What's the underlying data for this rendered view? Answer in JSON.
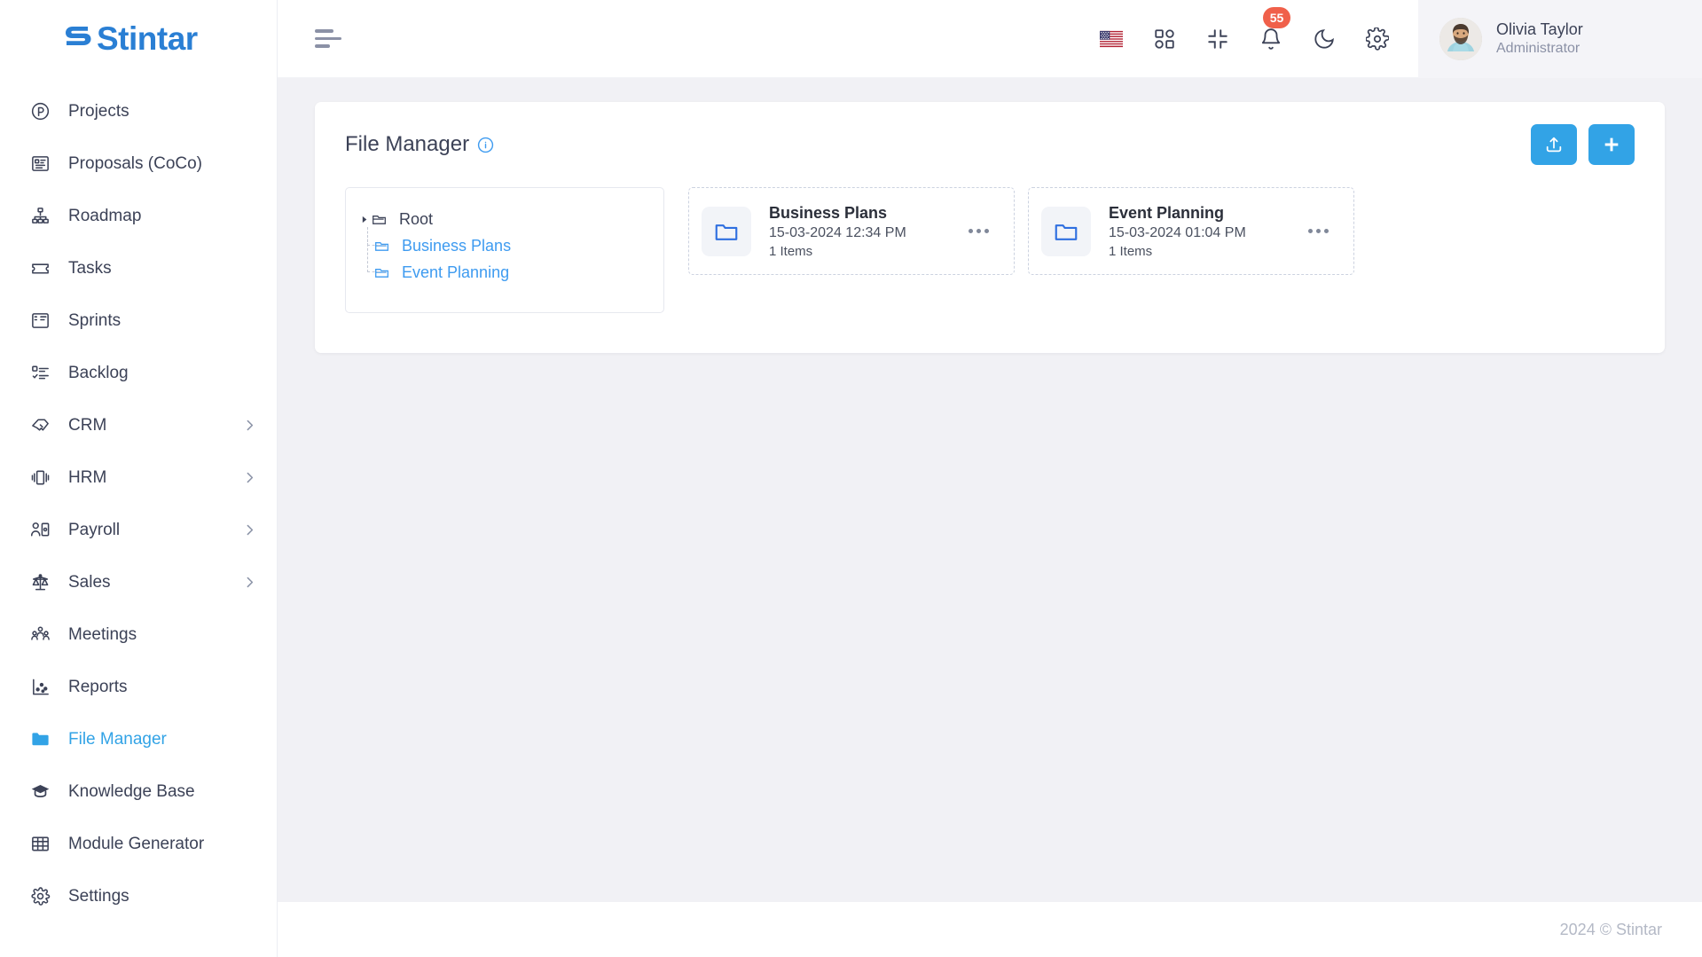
{
  "brand": {
    "name": "Stintar",
    "logo_color": "#2a7fd4"
  },
  "sidebar": {
    "items": [
      {
        "label": "Projects",
        "icon": "circle-p-icon",
        "active": false,
        "has_chevron": false
      },
      {
        "label": "Proposals (CoCo)",
        "icon": "proposal-icon",
        "active": false,
        "has_chevron": false
      },
      {
        "label": "Roadmap",
        "icon": "sitemap-icon",
        "active": false,
        "has_chevron": false
      },
      {
        "label": "Tasks",
        "icon": "ticket-icon",
        "active": false,
        "has_chevron": false
      },
      {
        "label": "Sprints",
        "icon": "board-icon",
        "active": false,
        "has_chevron": false
      },
      {
        "label": "Backlog",
        "icon": "checklist-icon",
        "active": false,
        "has_chevron": false
      },
      {
        "label": "CRM",
        "icon": "handshake-icon",
        "active": false,
        "has_chevron": true
      },
      {
        "label": "HRM",
        "icon": "cards-icon",
        "active": false,
        "has_chevron": true
      },
      {
        "label": "Payroll",
        "icon": "user-money-icon",
        "active": false,
        "has_chevron": true
      },
      {
        "label": "Sales",
        "icon": "scale-icon",
        "active": false,
        "has_chevron": true
      },
      {
        "label": "Meetings",
        "icon": "people-group-icon",
        "active": false,
        "has_chevron": false
      },
      {
        "label": "Reports",
        "icon": "scatter-chart-icon",
        "active": false,
        "has_chevron": false
      },
      {
        "label": "File Manager",
        "icon": "folder-icon",
        "active": true,
        "has_chevron": false
      },
      {
        "label": "Knowledge Base",
        "icon": "graduation-cap-icon",
        "active": false,
        "has_chevron": false
      },
      {
        "label": "Module Generator",
        "icon": "grid-table-icon",
        "active": false,
        "has_chevron": false
      },
      {
        "label": "Settings",
        "icon": "gear-icon",
        "active": false,
        "has_chevron": false
      }
    ]
  },
  "topbar": {
    "menu_toggle": "hamburger-menu",
    "icons": [
      {
        "name": "language-flag-us",
        "label": "US"
      },
      {
        "name": "apps-grid-icon",
        "label": "Apps"
      },
      {
        "name": "compress-icon",
        "label": "Compress"
      },
      {
        "name": "notification-bell-icon",
        "label": "Notifications",
        "badge": "55"
      },
      {
        "name": "dark-mode-moon-icon",
        "label": "Dark mode"
      },
      {
        "name": "settings-gear-icon",
        "label": "Settings"
      }
    ],
    "notification_badge": "55",
    "badge_color": "#f0604a",
    "user": {
      "name": "Olivia Taylor",
      "role": "Administrator"
    }
  },
  "panel": {
    "title": "File Manager",
    "info_icon": "info-circle-icon",
    "actions": [
      {
        "name": "upload-button",
        "icon": "upload-icon"
      },
      {
        "name": "add-button",
        "icon": "plus-icon"
      }
    ],
    "accent_color": "#32a3e6"
  },
  "tree": {
    "root": {
      "label": "Root",
      "expanded": true
    },
    "children": [
      {
        "label": "Business Plans"
      },
      {
        "label": "Event Planning"
      }
    ]
  },
  "folders": [
    {
      "name": "Business Plans",
      "date": "15-03-2024 12:34 PM",
      "items": "1 Items"
    },
    {
      "name": "Event Planning",
      "date": "15-03-2024 01:04 PM",
      "items": "1 Items"
    }
  ],
  "footer": {
    "text": "2024 © Stintar"
  }
}
